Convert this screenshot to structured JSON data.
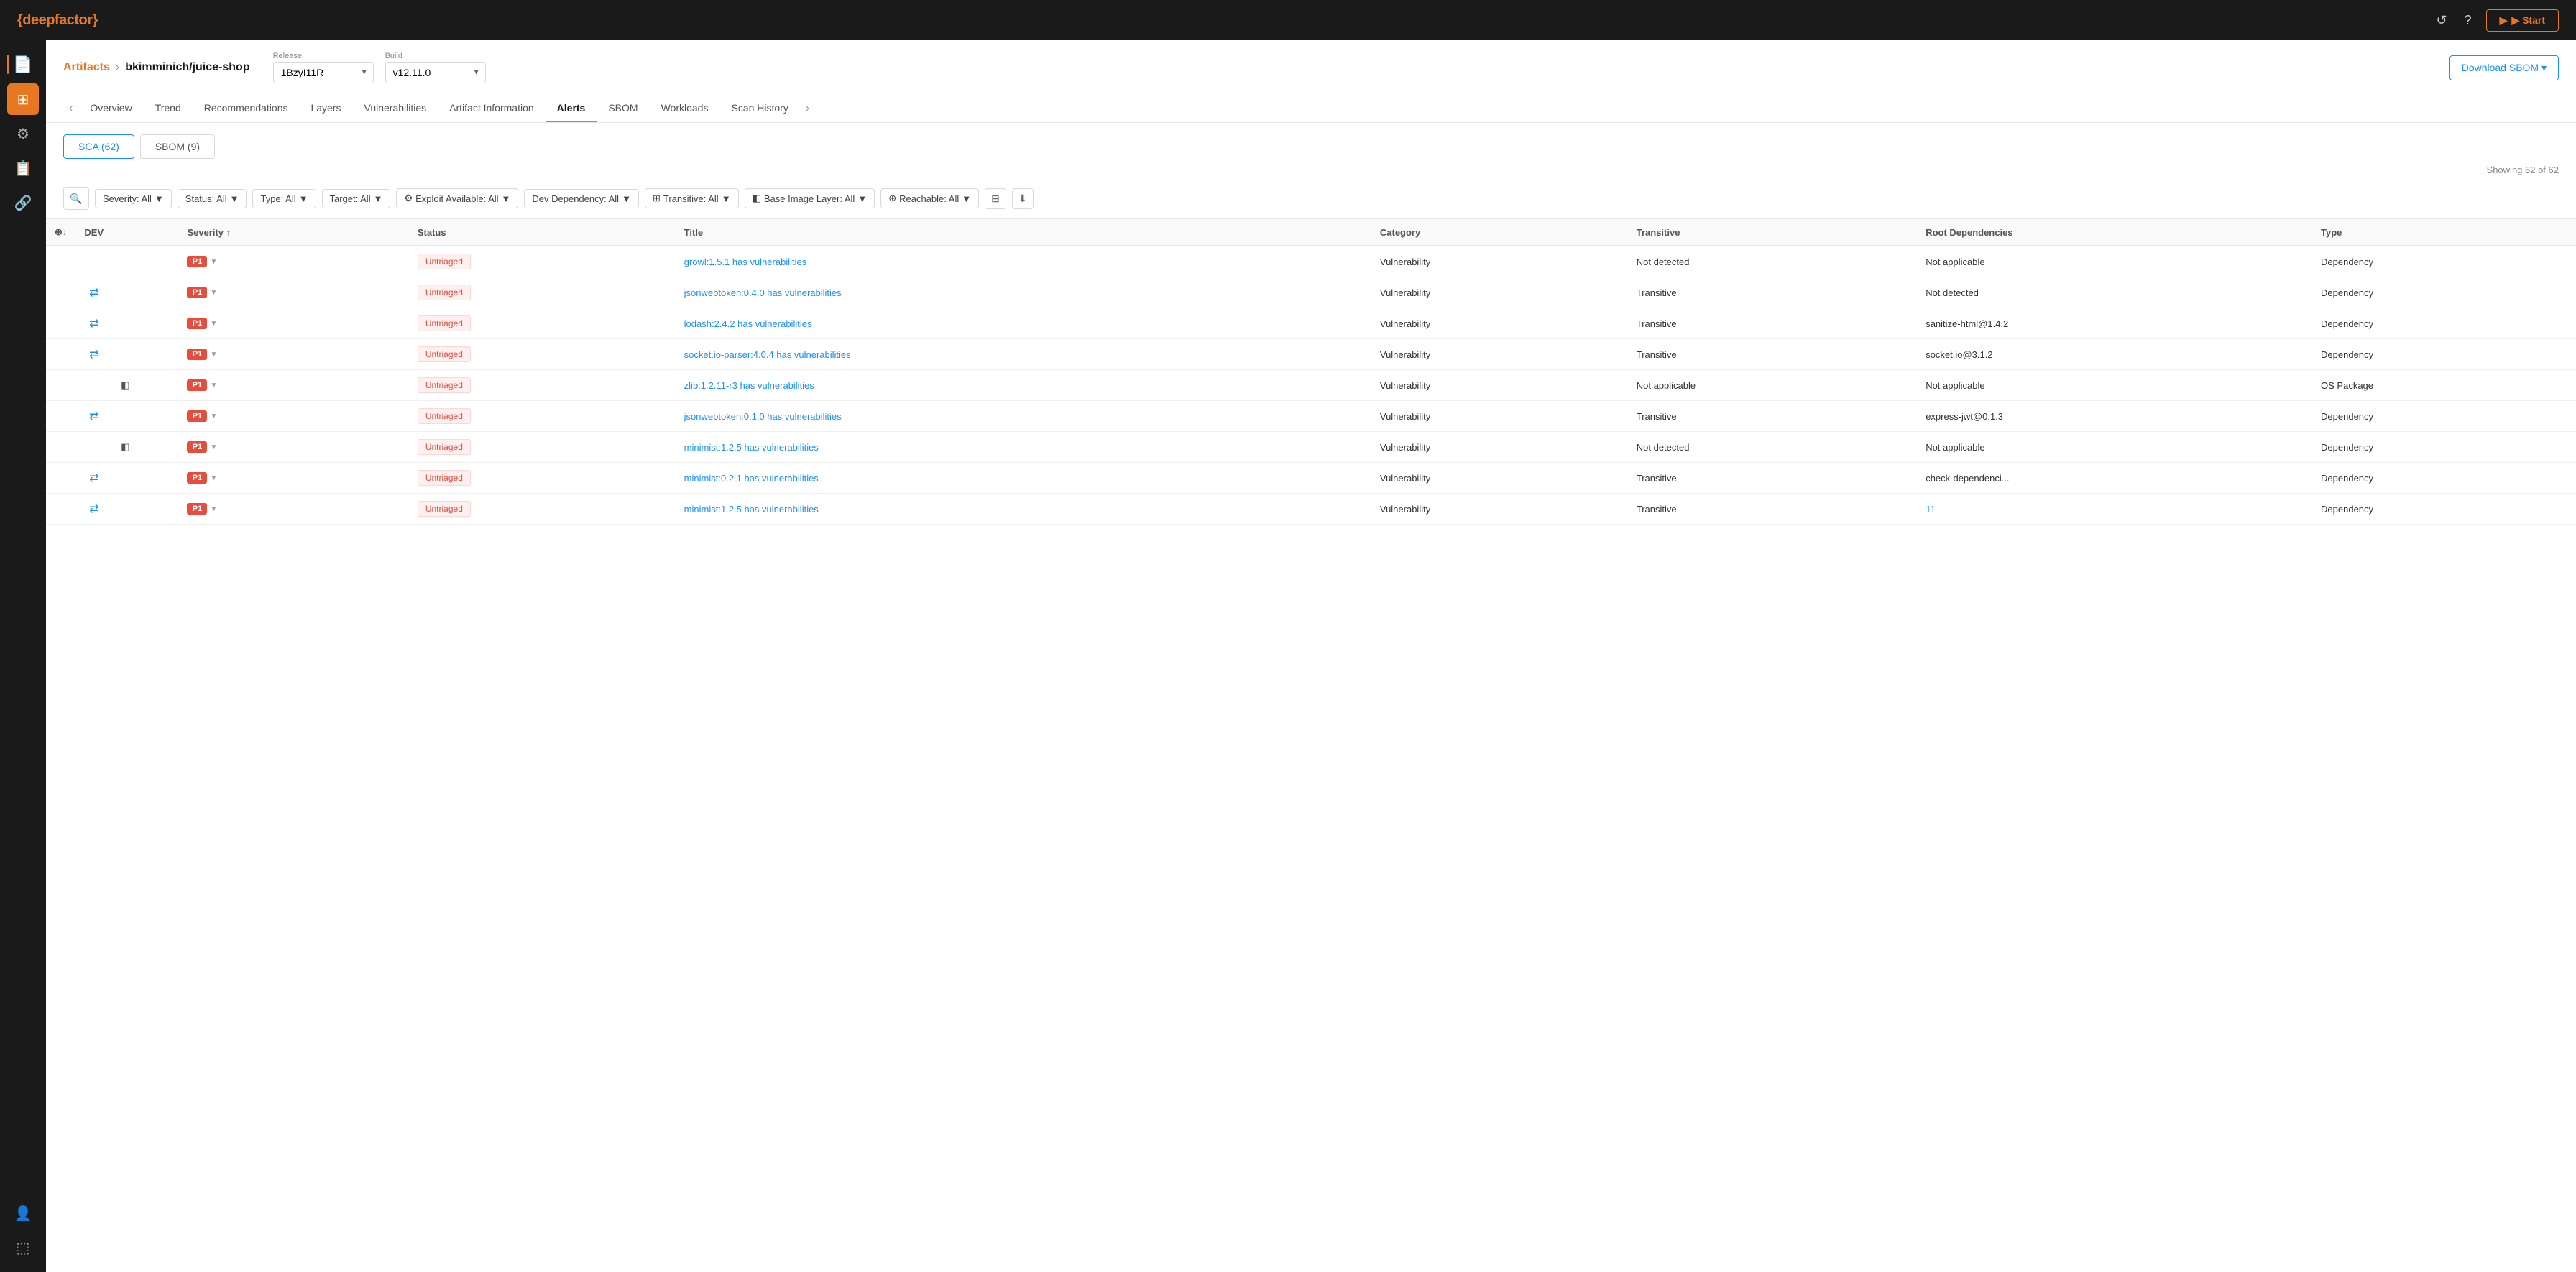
{
  "app": {
    "logo": "{deepfactor}",
    "logo_brand": "{deepfactor}",
    "title": "deepfactor"
  },
  "topbar": {
    "refresh_label": "↺",
    "help_label": "?",
    "start_label": "▶ Start"
  },
  "breadcrumb": {
    "link_label": "Artifacts",
    "separator": "›",
    "current": "bkimminich/juice-shop"
  },
  "release": {
    "label": "Release",
    "value": "1BzyI11R"
  },
  "build": {
    "label": "Build",
    "value": "v12.11.0"
  },
  "download_sbom": "Download SBOM ▾",
  "tabs": [
    {
      "label": "Overview",
      "active": false
    },
    {
      "label": "Trend",
      "active": false
    },
    {
      "label": "Recommendations",
      "active": false
    },
    {
      "label": "Layers",
      "active": false
    },
    {
      "label": "Vulnerabilities",
      "active": false
    },
    {
      "label": "Artifact Information",
      "active": false
    },
    {
      "label": "Alerts",
      "active": true
    },
    {
      "label": "SBOM",
      "active": false
    },
    {
      "label": "Workloads",
      "active": false
    },
    {
      "label": "Scan History",
      "active": false
    }
  ],
  "sub_tabs": [
    {
      "label": "SCA (62)",
      "active": true
    },
    {
      "label": "SBOM (9)",
      "active": false
    }
  ],
  "showing": "Showing 62 of 62",
  "filters": [
    {
      "label": "Severity: All",
      "icon": "▼"
    },
    {
      "label": "Status: All",
      "icon": "▼"
    },
    {
      "label": "Type: All",
      "icon": "▼"
    },
    {
      "label": "Target: All",
      "icon": "▼"
    },
    {
      "label": "⚙ Exploit Available: All",
      "icon": "▼"
    },
    {
      "label": "Dev Dependency: All",
      "icon": "▼"
    },
    {
      "label": "⊞ Transitive: All",
      "icon": "▼"
    },
    {
      "label": "◧ Base Image Layer: All",
      "icon": "▼"
    },
    {
      "label": "⊕ Reachable: All",
      "icon": "▼"
    }
  ],
  "table_headers": [
    "",
    "DEV",
    "",
    "",
    "",
    "Severity ↑",
    "Status",
    "Title",
    "Category",
    "Transitive",
    "Root Dependencies",
    "Type"
  ],
  "rows": [
    {
      "icons": [
        "",
        "",
        "",
        "",
        ""
      ],
      "severity": "P1",
      "status": "Untriaged",
      "title": "growl:1.5.1 has vulnerabilities",
      "category": "Vulnerability",
      "transitive": "Not detected",
      "root_deps": "Not applicable",
      "type": "Dependency"
    },
    {
      "icons": [
        "",
        "⇄",
        "",
        "",
        ""
      ],
      "severity": "P1",
      "status": "Untriaged",
      "title": "jsonwebtoken:0.4.0 has vulnerabilities",
      "category": "Vulnerability",
      "transitive": "Transitive",
      "root_deps": "Not detected",
      "type": "Dependency"
    },
    {
      "icons": [
        "",
        "⇄",
        "",
        "",
        ""
      ],
      "severity": "P1",
      "status": "Untriaged",
      "title": "lodash:2.4.2 has vulnerabilities",
      "category": "Vulnerability",
      "transitive": "Transitive",
      "root_deps": "sanitize-html@1.4.2",
      "type": "Dependency"
    },
    {
      "icons": [
        "",
        "⇄",
        "",
        "",
        ""
      ],
      "severity": "P1",
      "status": "Untriaged",
      "title": "socket.io-parser:4.0.4 has vulnerabilities",
      "category": "Vulnerability",
      "transitive": "Transitive",
      "root_deps": "socket.io@3.1.2",
      "type": "Dependency"
    },
    {
      "icons": [
        "",
        "",
        "◧",
        "",
        ""
      ],
      "severity": "P1",
      "status": "Untriaged",
      "title": "zlib:1.2.11-r3 has vulnerabilities",
      "category": "Vulnerability",
      "transitive": "Not applicable",
      "root_deps": "Not applicable",
      "type": "OS Package"
    },
    {
      "icons": [
        "",
        "⇄",
        "",
        "",
        ""
      ],
      "severity": "P1",
      "status": "Untriaged",
      "title": "jsonwebtoken:0.1.0 has vulnerabilities",
      "category": "Vulnerability",
      "transitive": "Transitive",
      "root_deps": "express-jwt@0.1.3",
      "type": "Dependency"
    },
    {
      "icons": [
        "",
        "",
        "◧",
        "",
        ""
      ],
      "severity": "P1",
      "status": "Untriaged",
      "title": "minimist:1.2.5 has vulnerabilities",
      "category": "Vulnerability",
      "transitive": "Not detected",
      "root_deps": "Not applicable",
      "type": "Dependency"
    },
    {
      "icons": [
        "",
        "⇄",
        "",
        "",
        ""
      ],
      "severity": "P1",
      "status": "Untriaged",
      "title": "minimist:0.2.1 has vulnerabilities",
      "category": "Vulnerability",
      "transitive": "Transitive",
      "root_deps": "check-dependenci...",
      "type": "Dependency"
    },
    {
      "icons": [
        "",
        "⇄",
        "",
        "",
        ""
      ],
      "severity": "P1",
      "status": "Untriaged",
      "title": "minimist:1.2.5 has vulnerabilities",
      "category": "Vulnerability",
      "transitive": "Transitive",
      "root_deps": "11",
      "root_deps_link": true,
      "type": "Dependency"
    }
  ],
  "sidebar": {
    "items": [
      {
        "icon": "▣",
        "label": "Dashboard",
        "active": true,
        "left_active": true
      },
      {
        "icon": "⊞",
        "label": "Grid"
      },
      {
        "icon": "⚙",
        "label": "Settings"
      },
      {
        "icon": "📄",
        "label": "Documents"
      },
      {
        "icon": "🔗",
        "label": "Links"
      }
    ],
    "bottom_items": [
      {
        "icon": "👤",
        "label": "User"
      },
      {
        "icon": "⬚",
        "label": "Logout"
      }
    ]
  }
}
